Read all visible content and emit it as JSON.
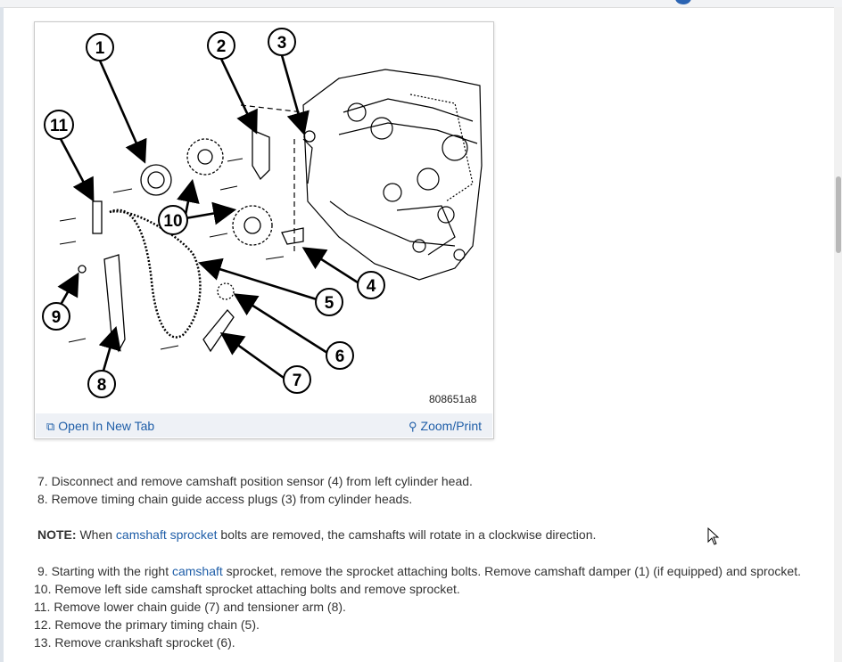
{
  "figure": {
    "image_id": "808651a8",
    "callouts": [
      "1",
      "2",
      "3",
      "4",
      "5",
      "6",
      "7",
      "8",
      "9",
      "10",
      "11"
    ],
    "open_new_tab": "Open In New Tab",
    "zoom_print": "Zoom/Print"
  },
  "steps_a": [
    {
      "num": "7.",
      "text": "Disconnect and remove camshaft position sensor (4) from left cylinder head."
    },
    {
      "num": "8.",
      "text": "Remove timing chain guide access plugs (3) from cylinder heads."
    }
  ],
  "note": {
    "label": "NOTE:",
    "pre": " When ",
    "link": "camshaft sprocket",
    "post": " bolts are removed, the camshafts will rotate in a clockwise direction."
  },
  "step9": {
    "num": "9.",
    "pre": "Starting with the right ",
    "link": "camshaft",
    "post": " sprocket, remove the sprocket attaching bolts. Remove camshaft damper (1) (if equipped) and sprocket."
  },
  "steps_b": [
    {
      "num": "10.",
      "text": "Remove left side camshaft sprocket attaching bolts and remove sprocket."
    },
    {
      "num": "11.",
      "text": "Remove lower chain guide (7) and tensioner arm (8)."
    },
    {
      "num": "12.",
      "text": "Remove the primary timing chain (5)."
    },
    {
      "num": "13.",
      "text": "Remove crankshaft sprocket (6)."
    }
  ],
  "colors": {
    "link": "#1f5ea8",
    "footer_bg": "#eef1f6"
  }
}
